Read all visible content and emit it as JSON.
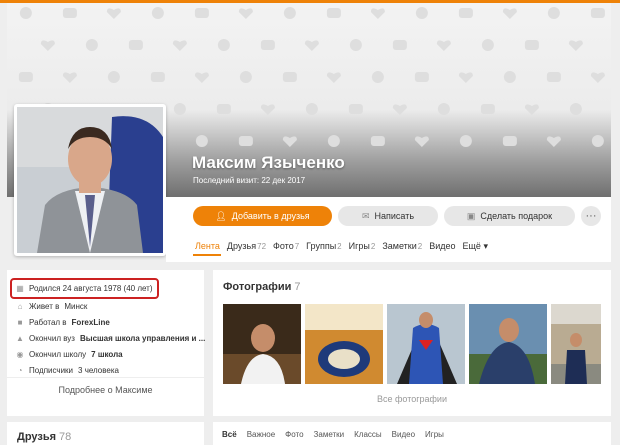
{
  "profile": {
    "name": "Максим Языченко",
    "last_visit": "Последний визит: 22 дек 2017"
  },
  "actions": {
    "add_friend": "Добавить в друзья",
    "message": "Написать",
    "gift": "Сделать подарок",
    "more": "···"
  },
  "tabs": [
    {
      "label": "Лента",
      "count": ""
    },
    {
      "label": "Друзья",
      "count": "72"
    },
    {
      "label": "Фото",
      "count": "7"
    },
    {
      "label": "Группы",
      "count": "2"
    },
    {
      "label": "Игры",
      "count": "2"
    },
    {
      "label": "Заметки",
      "count": "2"
    },
    {
      "label": "Видео",
      "count": ""
    },
    {
      "label": "Ещё",
      "count": "▾"
    }
  ],
  "about": {
    "born": "Родился 24 августа 1978 (40 лет)",
    "lives_prefix": "Живет в",
    "lives_city": "Минск",
    "works_prefix": "Работал в",
    "works_company": "ForexLine",
    "univ_prefix": "Окончил вуз",
    "univ_name": "Высшая школа управления и ...",
    "school_prefix": "Окончил школу",
    "school_name": "7 школа",
    "subs_prefix": "Подписчики",
    "subs_count": "3 человека",
    "more": "Подробнее о Максиме"
  },
  "photos": {
    "title": "Фотографии",
    "count": "7",
    "all": "Все фотографии"
  },
  "friends": {
    "title": "Друзья",
    "count": "78"
  },
  "feed_tabs": [
    "Всё",
    "Важное",
    "Фото",
    "Заметки",
    "Классы",
    "Видео",
    "Игры"
  ],
  "colors": {
    "accent": "#ee8208",
    "highlight": "#cc2222"
  }
}
